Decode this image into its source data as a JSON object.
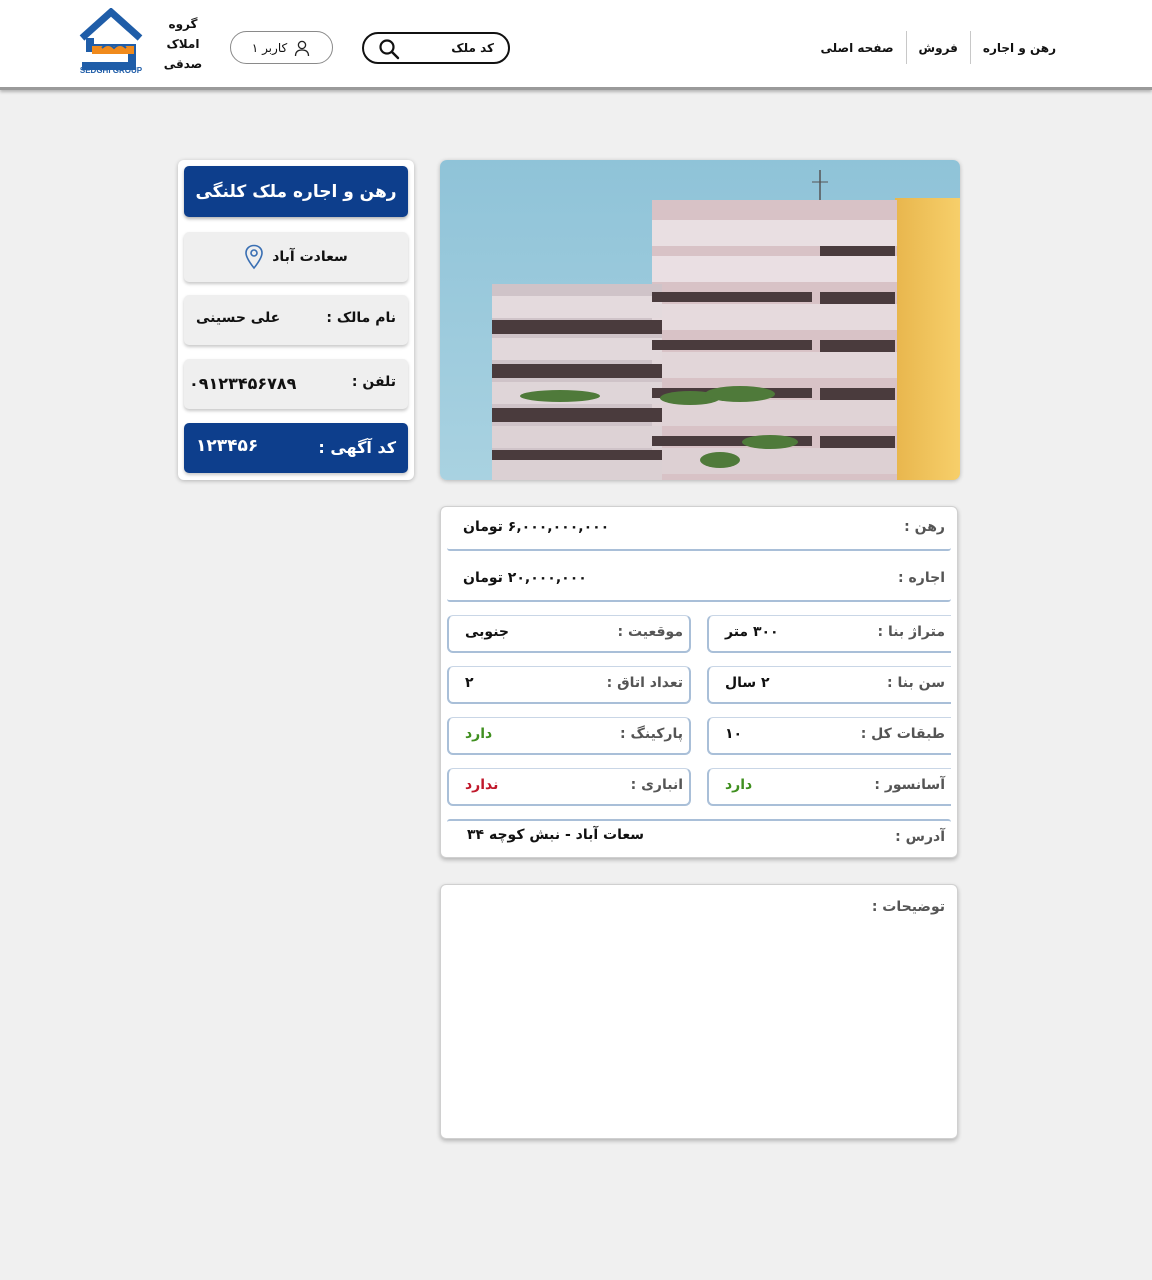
{
  "brand": {
    "name": "گروه املاک صدقی",
    "logo_caption": "SEDGHI GROUP",
    "colors": {
      "blue": "#1f5da8",
      "orange": "#f08a1c"
    }
  },
  "header": {
    "user_label": "کاربر ۱",
    "search_placeholder": "کد ملک",
    "nav": [
      "صفحه اصلی",
      "فروش",
      "رهن و اجاره"
    ]
  },
  "listing": {
    "title": "رهن و اجاره ملک کلنگی",
    "location": "سعادت آباد",
    "owner_label": "نام مالک :",
    "owner": "علی حسینی",
    "phone_label": "تلفن :",
    "phone": "۰۹۱۲۳۴۵۶۷۸۹",
    "code_label": "کد آگهی :",
    "code": "۱۲۳۴۵۶"
  },
  "details": {
    "mortgage_label": "رهن :",
    "mortgage": "۶,۰۰۰,۰۰۰,۰۰۰ تومان",
    "rent_label": "اجاره :",
    "rent": "۲۰,۰۰۰,۰۰۰ تومان",
    "area_label": "متراژ بنا :",
    "area": "۳۰۰ متر",
    "position_label": "موقعیت :",
    "position": "جنوبی",
    "age_label": "سن بنا :",
    "age": "۲ سال",
    "rooms_label": "تعداد اتاق :",
    "rooms": "۲",
    "floors_label": "طبقات کل :",
    "floors": "۱۰",
    "parking_label": "پارکینگ :",
    "parking": "دارد",
    "elevator_label": "آسانسور :",
    "elevator": "دارد",
    "storage_label": "انباری :",
    "storage": "ندارد",
    "address_label": "آدرس :",
    "address": "سعات آباد - نبش کوچه ۳۴"
  },
  "description": {
    "label": "توضیحات :",
    "text": ""
  },
  "colors": {
    "primary": "#0d3e8c",
    "positive": "#3f8f1f",
    "negative": "#c0182b",
    "row_border": "#a9bfd8"
  }
}
